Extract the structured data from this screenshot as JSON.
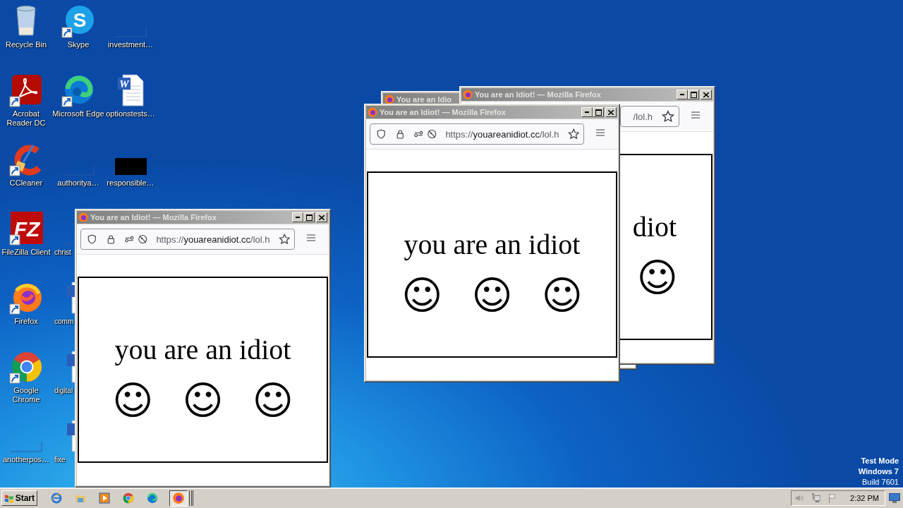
{
  "desktop_icons": [
    {
      "label": "Recycle Bin",
      "kind": "bin",
      "shortcut": false
    },
    {
      "label": "Acrobat Reader DC",
      "kind": "acrobat",
      "shortcut": true
    },
    {
      "label": "CCleaner",
      "kind": "ccleaner",
      "shortcut": true
    },
    {
      "label": "FileZilla Client",
      "kind": "filezilla",
      "shortcut": true,
      "glyph": "FZ"
    },
    {
      "label": "Firefox",
      "kind": "firefox",
      "shortcut": true
    },
    {
      "label": "Google Chrome",
      "kind": "chrome",
      "shortcut": true
    },
    {
      "label": "anotherpos…",
      "kind": "blank",
      "shortcut": false
    },
    {
      "label": "Skype",
      "kind": "skype",
      "shortcut": true,
      "glyph": "S"
    },
    {
      "label": "Microsoft Edge",
      "kind": "edge",
      "shortcut": true
    },
    {
      "label": "authoritya…",
      "kind": "blank",
      "shortcut": false
    },
    {
      "label": "christ",
      "kind": "blank",
      "shortcut": false
    },
    {
      "label": "comm",
      "kind": "word",
      "shortcut": false
    },
    {
      "label": "digital",
      "kind": "word",
      "shortcut": false
    },
    {
      "label": "fixe",
      "kind": "word",
      "shortcut": false
    },
    {
      "label": "investment…",
      "kind": "blank",
      "shortcut": false
    },
    {
      "label": "optionstests…",
      "kind": "word",
      "shortcut": false,
      "glyph": "W"
    },
    {
      "label": "responsible…",
      "kind": "black",
      "shortcut": false
    }
  ],
  "windows": [
    {
      "kind": "title",
      "title": "You are an Idio"
    },
    {
      "kind": "partial",
      "title": "You are an Idiot! — Mozilla Firefox",
      "url": {
        "path": "/lol.h"
      },
      "message": "diot",
      "smileys": [
        "☺"
      ]
    },
    {
      "kind": "full",
      "title": "You are an Idiot! — Mozilla Firefox",
      "url": {
        "scheme": "https://",
        "host": "youareanidiot.cc",
        "path": "/lol.h"
      },
      "message": "you are an idiot",
      "smileys": [
        "☺",
        "☺",
        "☺"
      ]
    },
    {
      "kind": "full",
      "title": "You are an Idiot! — Mozilla Firefox",
      "url": {
        "scheme": "https://",
        "host": "youareanidiot.cc",
        "path": "/lol.h"
      },
      "message": "you are an idiot",
      "smileys": [
        "☺",
        "☺",
        "☺"
      ]
    }
  ],
  "os_notice": [
    {
      "text": "Test Mode",
      "bold": true
    },
    {
      "text": "Windows 7",
      "bold": true
    },
    {
      "text": "Build 7601",
      "bold": false
    }
  ],
  "taskbar": {
    "start_label": "Start",
    "clock": "2:32 PM"
  }
}
